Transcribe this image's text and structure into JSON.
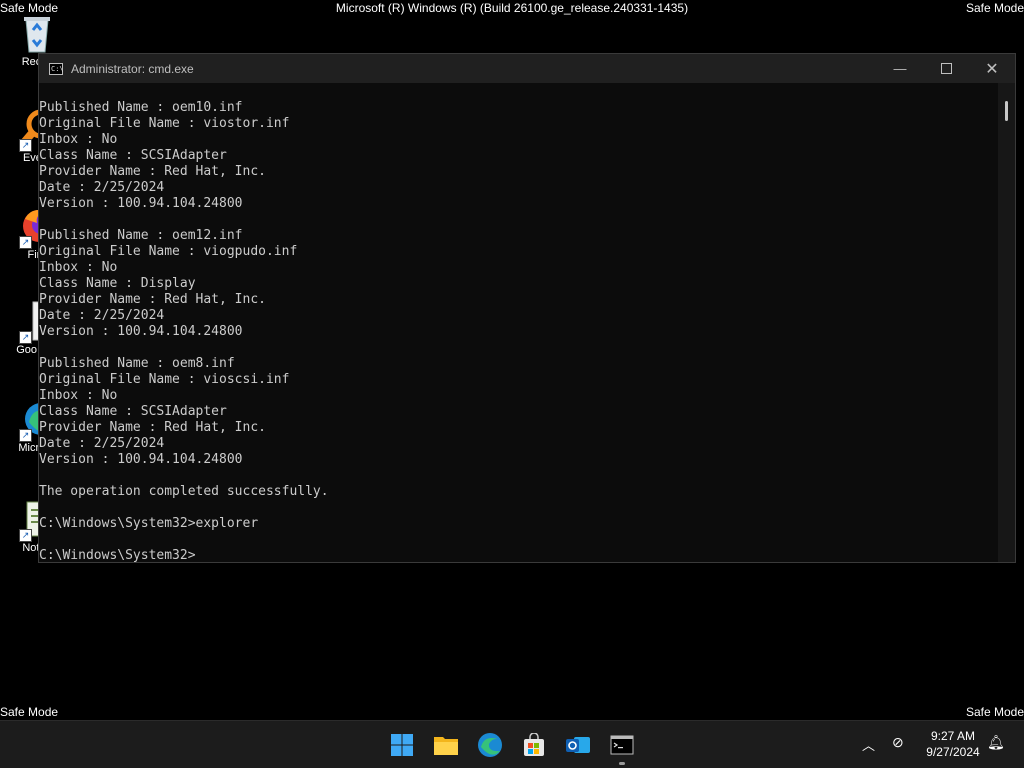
{
  "watermarks": {
    "top_left": "Safe Mode",
    "top_right": "Safe Mode",
    "top_center": "Microsoft (R) Windows (R) (Build 26100.ge_release.240331-1435)",
    "bottom_left": "Safe Mode",
    "bottom_right": "Safe Mode"
  },
  "desktop_icons": [
    {
      "label": "Recyc"
    },
    {
      "label": "Every"
    },
    {
      "label": "Fire"
    },
    {
      "label": "Goo Chr"
    },
    {
      "label": "Micr Ed"
    },
    {
      "label": "Notep"
    }
  ],
  "cmd_window": {
    "title": "Administrator: cmd.exe",
    "lines": [
      "Published Name : oem10.inf",
      "Original File Name : viostor.inf",
      "Inbox : No",
      "Class Name : SCSIAdapter",
      "Provider Name : Red Hat, Inc.",
      "Date : 2/25/2024",
      "Version : 100.94.104.24800",
      "",
      "Published Name : oem12.inf",
      "Original File Name : viogpudo.inf",
      "Inbox : No",
      "Class Name : Display",
      "Provider Name : Red Hat, Inc.",
      "Date : 2/25/2024",
      "Version : 100.94.104.24800",
      "",
      "Published Name : oem8.inf",
      "Original File Name : vioscsi.inf",
      "Inbox : No",
      "Class Name : SCSIAdapter",
      "Provider Name : Red Hat, Inc.",
      "Date : 2/25/2024",
      "Version : 100.94.104.24800",
      "",
      "The operation completed successfully.",
      "",
      "C:\\Windows\\System32>explorer",
      "",
      "C:\\Windows\\System32>"
    ]
  },
  "taskbar": {
    "apps": [
      {
        "name": "start-icon"
      },
      {
        "name": "file-explorer-icon"
      },
      {
        "name": "edge-icon"
      },
      {
        "name": "store-icon"
      },
      {
        "name": "outlook-icon"
      },
      {
        "name": "terminal-icon"
      }
    ],
    "clock": {
      "time": "9:27 AM",
      "date": "9/27/2024"
    }
  },
  "colors": {
    "console_bg": "#0c0c0c",
    "console_text": "#cccccc",
    "titlebar_bg": "#202020",
    "taskbar_bg": "#1c1c1c"
  }
}
